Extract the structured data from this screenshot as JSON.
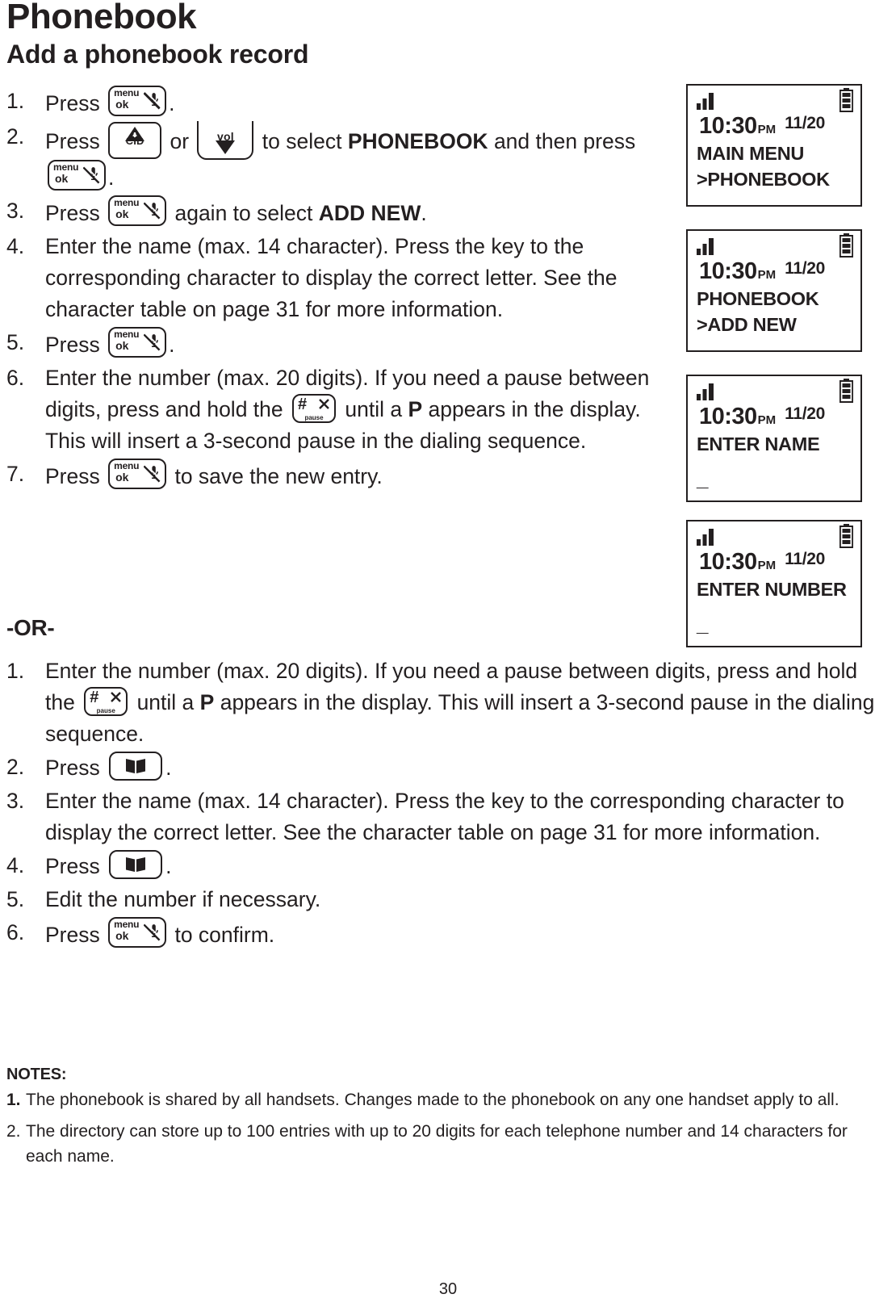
{
  "page": {
    "title": "Phonebook",
    "subtitle": "Add a phonebook record",
    "page_number": "30",
    "or_separator": "-OR-"
  },
  "keys": {
    "menu_ok": {
      "line1": "menu",
      "line2": "ok",
      "icon": "mute-microphone-icon"
    },
    "cid": {
      "label": "CID",
      "icon": "up-triangle-plus-icon"
    },
    "vol": {
      "label": "vol",
      "icon": "down-triangle-icon"
    },
    "pause": {
      "hash": "#",
      "label": "pause",
      "icon": "hash-pause-key-icon"
    },
    "phonebook": {
      "icon": "open-book-icon"
    }
  },
  "procedure_main": {
    "steps": [
      {
        "num": "1.",
        "before": "Press ",
        "key": "menu_ok",
        "after": "."
      },
      {
        "num": "2.",
        "before": "Press ",
        "key": "cid",
        "mid": " or ",
        "key2": "vol",
        "mid2": " to select ",
        "bold": "PHONEBOOK",
        "after": " and then press ",
        "key3": "menu_ok",
        "after2": "."
      },
      {
        "num": "3.",
        "before": "Press ",
        "key": "menu_ok",
        "mid": " again to select ",
        "bold": "ADD NEW",
        "after": "."
      },
      {
        "num": "4.",
        "text": "Enter the name (max. 14 character). Press the key to the corresponding character to display the correct letter. See the character table on page 31 for more information."
      },
      {
        "num": "5.",
        "before": "Press ",
        "key": "menu_ok",
        "after": "."
      },
      {
        "num": "6.",
        "before": "Enter the number (max. 20 digits). If you need a pause between digits, press and hold the ",
        "key": "pause",
        "mid": " until a ",
        "bold": "P",
        "after": " appears in the display. This will insert a 3-second pause in the dialing sequence."
      },
      {
        "num": "7.",
        "before": "Press ",
        "key": "menu_ok",
        "after": " to save the new entry."
      }
    ]
  },
  "procedure_alt": {
    "steps": [
      {
        "num": "1.",
        "before": "Enter the number (max. 20 digits). If you need a pause between digits, press and hold the ",
        "key": "pause",
        "mid": " until a ",
        "bold": "P",
        "after": " appears in the display. This will insert a 3-second pause in the dialing sequence."
      },
      {
        "num": "2.",
        "before": "Press ",
        "key": "phonebook",
        "after": "."
      },
      {
        "num": "3.",
        "text": "Enter the name (max. 14 character). Press the key to the corresponding character to display the correct letter. See the character table on page 31 for more information."
      },
      {
        "num": "4.",
        "before": "Press ",
        "key": "phonebook",
        "after": "."
      },
      {
        "num": "5.",
        "text": "Edit the number if necessary."
      },
      {
        "num": "6.",
        "before": "Press ",
        "key": "menu_ok",
        "after": " to confirm."
      }
    ]
  },
  "displays": [
    {
      "signal": "signal-strength-icon",
      "battery": "battery-full-icon",
      "time": "10:30",
      "ampm": "PM",
      "date": "11/20",
      "line1": "MAIN MENU",
      "line2": ">PHONEBOOK"
    },
    {
      "signal": "signal-strength-icon",
      "battery": "battery-full-icon",
      "time": "10:30",
      "ampm": "PM",
      "date": "11/20",
      "line1": "PHONEBOOK",
      "line2": ">ADD NEW"
    },
    {
      "signal": "signal-strength-icon",
      "battery": "battery-full-icon",
      "time": "10:30",
      "ampm": "PM",
      "date": "11/20",
      "line1": "ENTER NAME",
      "line2": "_"
    },
    {
      "signal": "signal-strength-icon",
      "battery": "battery-full-icon",
      "time": "10:30",
      "ampm": "PM",
      "date": "11/20",
      "line1": "ENTER NUMBER",
      "line2": "_"
    }
  ],
  "notes": {
    "heading": "NOTES:",
    "items": [
      {
        "num": "1.",
        "bold_num": true,
        "text": "The phonebook is shared by all handsets. Changes made to the phonebook on any one handset apply to all."
      },
      {
        "num": "2.",
        "bold_num": false,
        "text": "The directory can store up to 100 entries with up to 20 digits for each telephone number and 14 characters for each name."
      }
    ]
  }
}
